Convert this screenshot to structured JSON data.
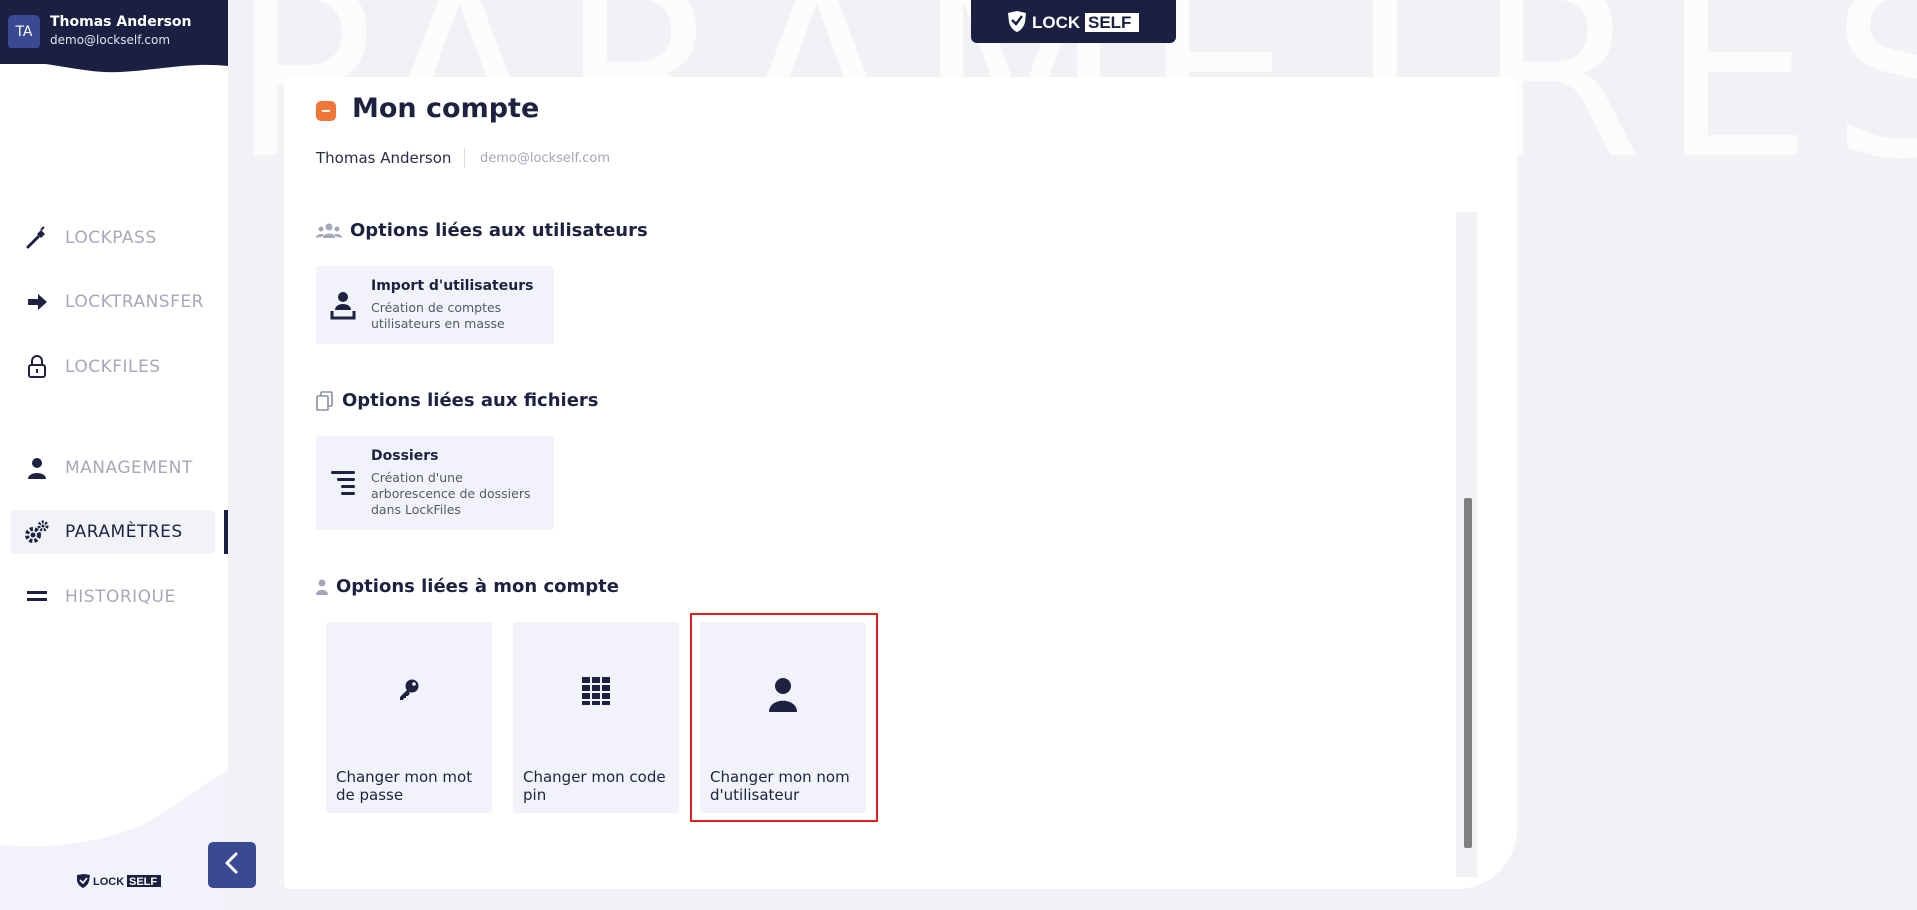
{
  "background_word": "PARAMÈTRES",
  "user": {
    "initials": "TA",
    "name": "Thomas Anderson",
    "email": "demo@lockself.com"
  },
  "brand": {
    "lock": "LOCK",
    "self": "SELF"
  },
  "nav": [
    {
      "label": "LOCKPASS",
      "icon": "pen-key-icon",
      "active": false
    },
    {
      "label": "LOCKTRANSFER",
      "icon": "arrow-right-icon",
      "active": false
    },
    {
      "label": "LOCKFILES",
      "icon": "padlock-icon",
      "active": false
    },
    {
      "label": "MANAGEMENT",
      "icon": "user-icon",
      "active": false
    },
    {
      "label": "PARAMÈTRES",
      "icon": "gears-icon",
      "active": true
    },
    {
      "label": "HISTORIQUE",
      "icon": "list-icon",
      "active": false
    }
  ],
  "page": {
    "title": "Mon compte",
    "account_name": "Thomas Anderson",
    "account_email": "demo@lockself.com"
  },
  "sections": {
    "users": {
      "title": "Options liées aux utilisateurs",
      "card": {
        "title": "Import d'utilisateurs",
        "desc": "Création de comptes utilisateurs en masse"
      }
    },
    "files": {
      "title": "Options liées aux fichiers",
      "card": {
        "title": "Dossiers",
        "desc": "Création d'une arborescence de dossiers dans LockFiles"
      }
    },
    "account": {
      "title": "Options liées à mon compte",
      "tiles": [
        {
          "label": "Changer mon mot de passe",
          "icon": "key-icon"
        },
        {
          "label": "Changer mon code pin",
          "icon": "keypad-icon"
        },
        {
          "label": "Changer mon nom d'utilisateur",
          "icon": "user-icon"
        }
      ]
    }
  },
  "colors": {
    "navy": "#1b1f42",
    "accent_blue": "#3a4a92",
    "orange": "#f07637",
    "highlight": "#e02020"
  }
}
